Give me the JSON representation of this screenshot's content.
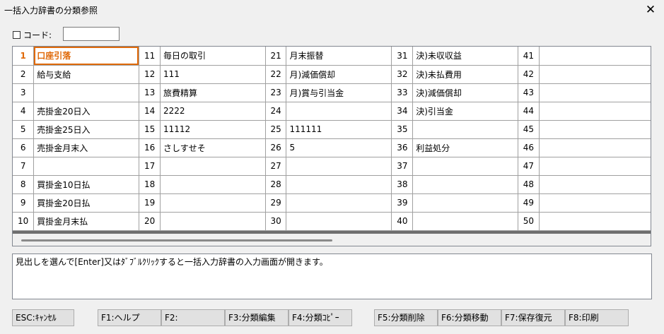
{
  "window": {
    "title": "一括入力辞書の分類参照",
    "close_glyph": "✕"
  },
  "code_filter": {
    "label": "コード:",
    "checked": false,
    "value": ""
  },
  "grid": {
    "rows": [
      [
        {
          "n": "1",
          "t": "口座引落"
        },
        {
          "n": "11",
          "t": "毎日の取引"
        },
        {
          "n": "21",
          "t": "月末振替"
        },
        {
          "n": "31",
          "t": "決)未収収益"
        },
        {
          "n": "41",
          "t": ""
        }
      ],
      [
        {
          "n": "2",
          "t": "給与支給"
        },
        {
          "n": "12",
          "t": "111"
        },
        {
          "n": "22",
          "t": "月)減価償却"
        },
        {
          "n": "32",
          "t": "決)未払費用"
        },
        {
          "n": "42",
          "t": ""
        }
      ],
      [
        {
          "n": "3",
          "t": ""
        },
        {
          "n": "13",
          "t": "旅費精算"
        },
        {
          "n": "23",
          "t": "月)賞与引当金"
        },
        {
          "n": "33",
          "t": "決)減価償却"
        },
        {
          "n": "43",
          "t": ""
        }
      ],
      [
        {
          "n": "4",
          "t": "売掛金20日入"
        },
        {
          "n": "14",
          "t": "2222"
        },
        {
          "n": "24",
          "t": ""
        },
        {
          "n": "34",
          "t": "決)引当金"
        },
        {
          "n": "44",
          "t": ""
        }
      ],
      [
        {
          "n": "5",
          "t": "売掛金25日入"
        },
        {
          "n": "15",
          "t": "11112"
        },
        {
          "n": "25",
          "t": "111111"
        },
        {
          "n": "35",
          "t": ""
        },
        {
          "n": "45",
          "t": ""
        }
      ],
      [
        {
          "n": "6",
          "t": "売掛金月末入"
        },
        {
          "n": "16",
          "t": "さしすせそ"
        },
        {
          "n": "26",
          "t": "5"
        },
        {
          "n": "36",
          "t": "利益処分"
        },
        {
          "n": "46",
          "t": ""
        }
      ],
      [
        {
          "n": "7",
          "t": ""
        },
        {
          "n": "17",
          "t": ""
        },
        {
          "n": "27",
          "t": ""
        },
        {
          "n": "37",
          "t": ""
        },
        {
          "n": "47",
          "t": ""
        }
      ],
      [
        {
          "n": "8",
          "t": "買掛金10日払"
        },
        {
          "n": "18",
          "t": ""
        },
        {
          "n": "28",
          "t": ""
        },
        {
          "n": "38",
          "t": ""
        },
        {
          "n": "48",
          "t": ""
        }
      ],
      [
        {
          "n": "9",
          "t": "買掛金20日払"
        },
        {
          "n": "19",
          "t": ""
        },
        {
          "n": "29",
          "t": ""
        },
        {
          "n": "39",
          "t": ""
        },
        {
          "n": "49",
          "t": ""
        }
      ],
      [
        {
          "n": "10",
          "t": "買掛金月末払"
        },
        {
          "n": "20",
          "t": ""
        },
        {
          "n": "30",
          "t": ""
        },
        {
          "n": "40",
          "t": ""
        },
        {
          "n": "50",
          "t": ""
        }
      ]
    ],
    "selected": "1"
  },
  "message": "見出しを選んで[Enter]又はﾀﾞﾌﾞﾙｸﾘｯｸすると一括入力辞書の入力画面が開きます。",
  "buttons": [
    {
      "id": "esc",
      "label": "ESC:ｷｬﾝｾﾙ"
    },
    {
      "id": "f1",
      "label": "F1:ヘルプ"
    },
    {
      "id": "f2",
      "label": "F2:"
    },
    {
      "id": "f3",
      "label": "F3:分類編集"
    },
    {
      "id": "f4",
      "label": "F4:分類ｺﾋﾟｰ"
    },
    {
      "id": "f5",
      "label": "F5:分類削除"
    },
    {
      "id": "f6",
      "label": "F6:分類移動"
    },
    {
      "id": "f7",
      "label": "F7:保存復元"
    },
    {
      "id": "f8",
      "label": "F8:印刷"
    }
  ],
  "colors": {
    "accent": "#e06a0a",
    "window_bg": "#f0f0f0"
  }
}
